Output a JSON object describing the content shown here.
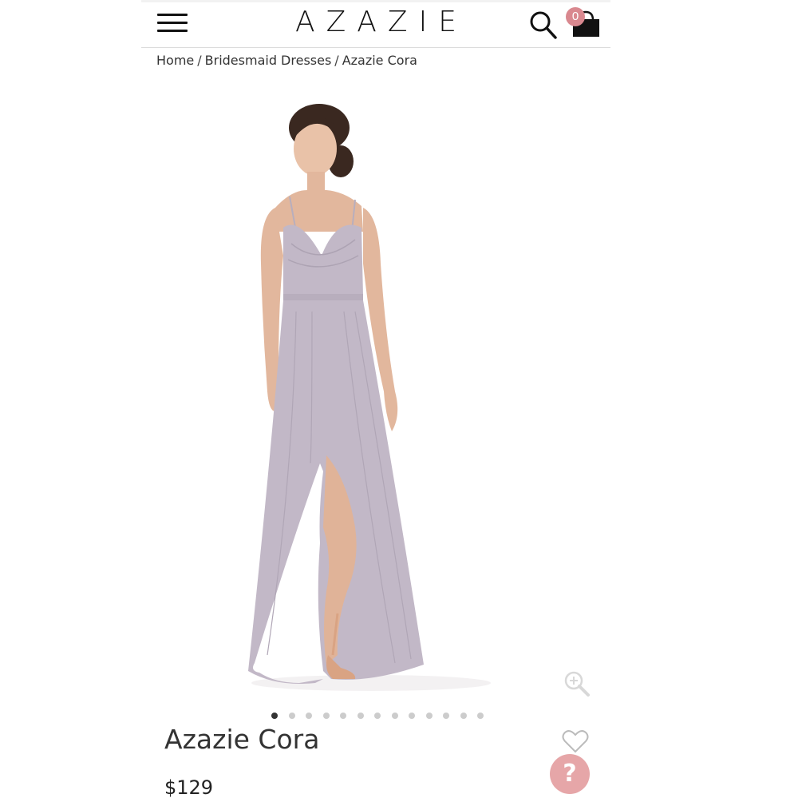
{
  "header": {
    "logo": "AZAZIE",
    "cart_count": "0"
  },
  "breadcrumb": {
    "items": [
      "Home",
      "Bridesmaid Dresses",
      "Azazie Cora"
    ],
    "separator": "/"
  },
  "product": {
    "title": "Azazie Cora",
    "price": "$129",
    "image_alt": "Model wearing lilac chiffon bridesmaid dress",
    "dress_color": "#c2b8c7"
  },
  "carousel": {
    "dot_count": 13,
    "active_index": 0
  },
  "help": {
    "label": "?"
  },
  "colors": {
    "accent": "#d9888f",
    "help_bg": "#e6a6a8"
  }
}
